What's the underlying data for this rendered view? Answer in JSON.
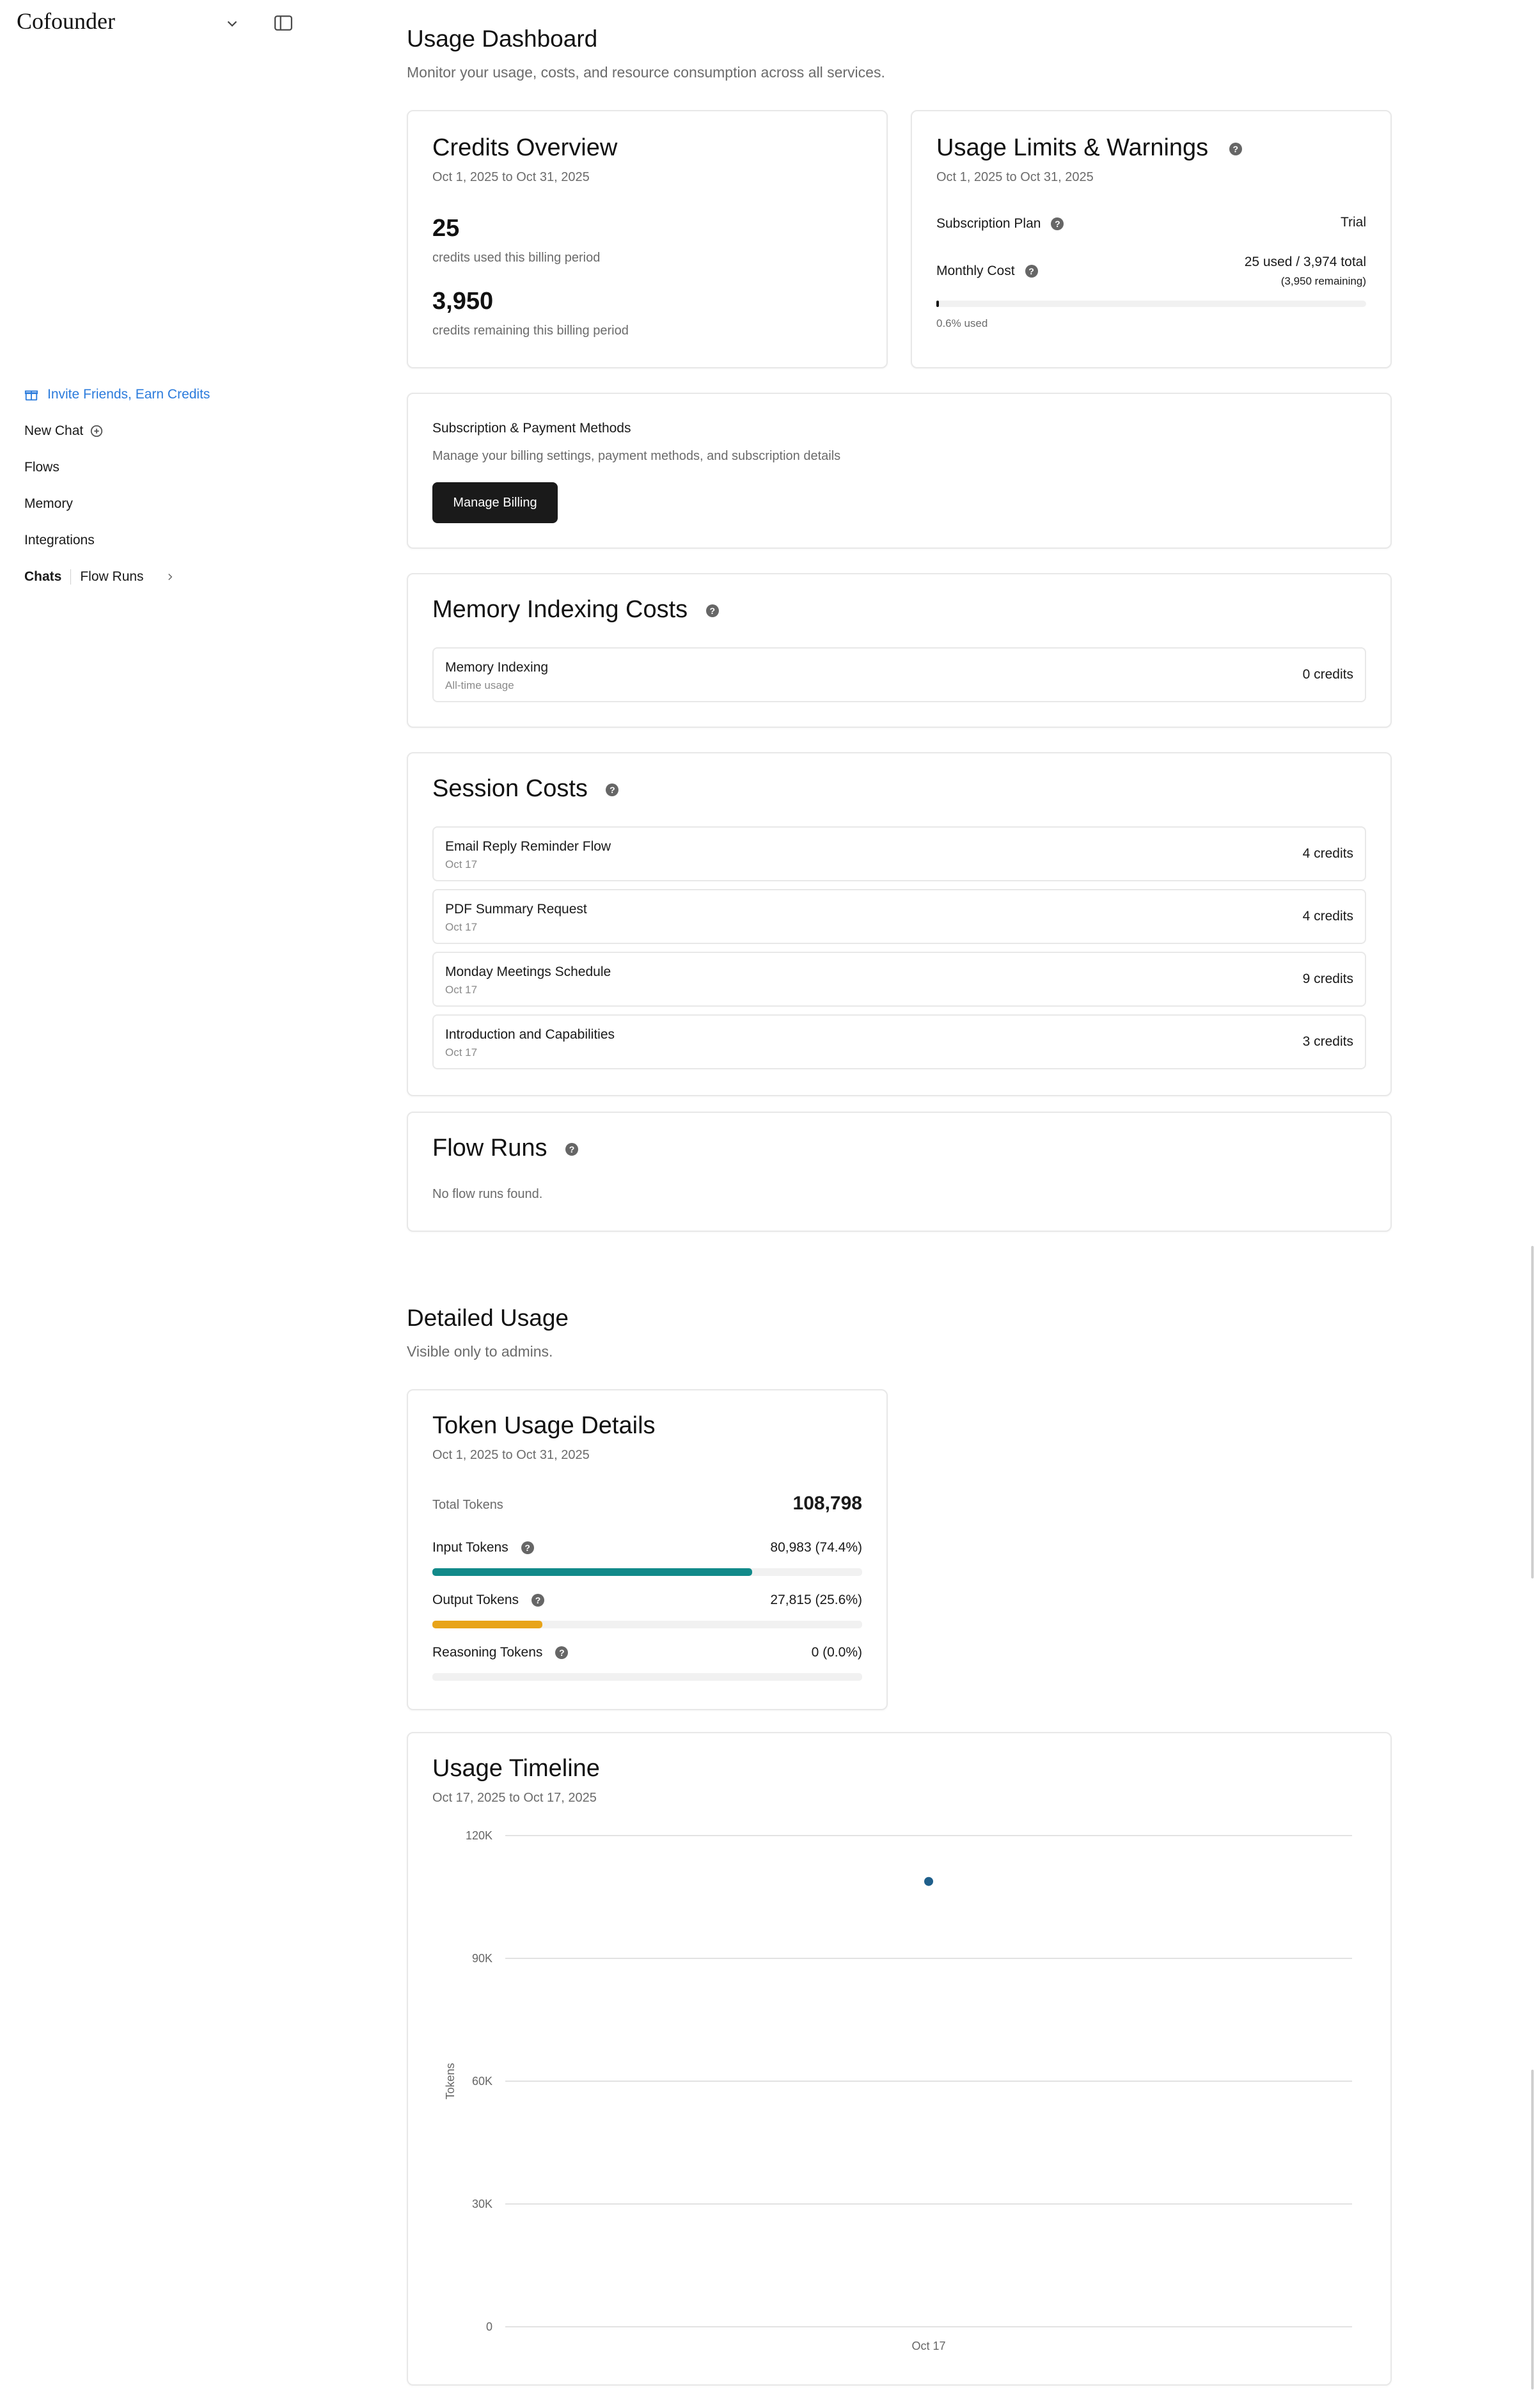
{
  "sidebar": {
    "brand": "Cofounder",
    "invite_label": "Invite Friends, Earn Credits",
    "new_chat_label": "New Chat",
    "items": [
      {
        "label": "Flows"
      },
      {
        "label": "Memory"
      },
      {
        "label": "Integrations"
      }
    ],
    "tabs": {
      "chats": "Chats",
      "flow_runs": "Flow Runs"
    }
  },
  "page": {
    "title": "Usage Dashboard",
    "subtitle": "Monitor your usage, costs, and resource consumption across all services."
  },
  "credits_overview": {
    "title": "Credits Overview",
    "date_range": "Oct 1, 2025 to Oct 31, 2025",
    "used_value": "25",
    "used_caption": "credits used this billing period",
    "remaining_value": "3,950",
    "remaining_caption": "credits remaining this billing period"
  },
  "usage_limits": {
    "title": "Usage Limits & Warnings",
    "date_range": "Oct 1, 2025 to Oct 31, 2025",
    "plan_label": "Subscription Plan",
    "plan_value": "Trial",
    "monthly_label": "Monthly Cost",
    "monthly_value": "25 used / 3,974 total",
    "monthly_remaining": "(3,950 remaining)",
    "used_percent_label": "0.6% used",
    "used_fraction": 0.006
  },
  "billing": {
    "title": "Subscription & Payment Methods",
    "description": "Manage your billing settings, payment methods, and subscription details",
    "button_label": "Manage Billing"
  },
  "memory_indexing": {
    "title": "Memory Indexing Costs",
    "row_name": "Memory Indexing",
    "row_sub": "All-time usage",
    "row_value": "0 credits"
  },
  "session_costs": {
    "title": "Session Costs",
    "rows": [
      {
        "name": "Email Reply Reminder Flow",
        "date": "Oct 17",
        "credits": "4 credits"
      },
      {
        "name": "PDF Summary Request",
        "date": "Oct 17",
        "credits": "4 credits"
      },
      {
        "name": "Monday Meetings Schedule",
        "date": "Oct 17",
        "credits": "9 credits"
      },
      {
        "name": "Introduction and Capabilities",
        "date": "Oct 17",
        "credits": "3 credits"
      }
    ]
  },
  "flow_runs": {
    "title": "Flow Runs",
    "empty": "No flow runs found."
  },
  "detailed": {
    "title": "Detailed Usage",
    "subtitle": "Visible only to admins."
  },
  "token_usage": {
    "title": "Token Usage Details",
    "date_range": "Oct 1, 2025 to Oct 31, 2025",
    "total_label": "Total Tokens",
    "total_value": "108,798",
    "input_label": "Input Tokens",
    "input_value": "80,983 (74.4%)",
    "input_fraction": 0.744,
    "output_label": "Output Tokens",
    "output_value": "27,815 (25.6%)",
    "output_fraction": 0.256,
    "reasoning_label": "Reasoning Tokens",
    "reasoning_value": "0 (0.0%)",
    "reasoning_fraction": 0,
    "colors": {
      "input": "#128a8a",
      "output": "#e8a419"
    }
  },
  "timeline": {
    "title": "Usage Timeline",
    "date_range": "Oct 17, 2025 to Oct 17, 2025"
  },
  "chart_data": {
    "type": "scatter",
    "x": [
      "Oct 17"
    ],
    "values": [
      108798
    ],
    "ylabel": "Tokens",
    "ylim": [
      0,
      120000
    ],
    "yticks": [
      0,
      30000,
      60000,
      90000,
      120000
    ],
    "ytick_labels": [
      "0",
      "30K",
      "60K",
      "90K",
      "120K"
    ],
    "grid": true,
    "color": "#1f5f8b"
  }
}
